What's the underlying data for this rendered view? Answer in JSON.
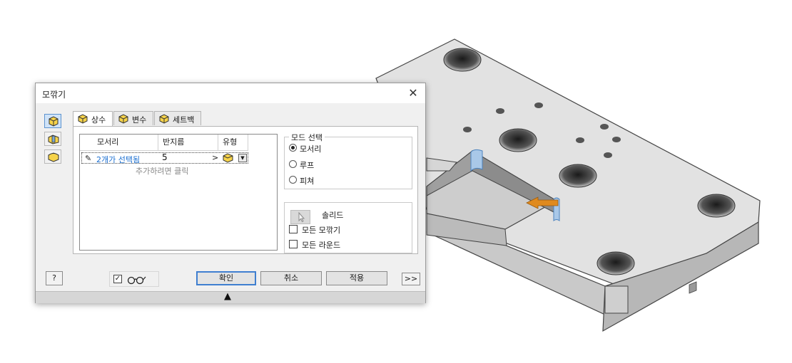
{
  "dialog": {
    "title": "모깎기",
    "close_glyph": "✕"
  },
  "side_tools": [
    {
      "icon": "edge-fillet-icon",
      "active": true
    },
    {
      "icon": "face-fillet-icon",
      "active": false
    },
    {
      "icon": "full-round-fillet-icon",
      "active": false
    }
  ],
  "tabs": [
    {
      "label": "상수",
      "active": true
    },
    {
      "label": "변수",
      "active": false
    },
    {
      "label": "세트백",
      "active": false
    }
  ],
  "table": {
    "headers": [
      "모서리",
      "반지름",
      "유형"
    ],
    "row": {
      "edges": "2개가 선택됨",
      "radius": "5",
      "arrow": ">"
    },
    "hint": "추가하려면 클릭"
  },
  "mode": {
    "legend": "모드 선택",
    "options": [
      "모서리",
      "루프",
      "피쳐"
    ],
    "selected": "모서리"
  },
  "solids": {
    "label": "솔리드",
    "all_fillets": "모든 모깎기",
    "all_rounds": "모든 라운드"
  },
  "buttons": {
    "help": "?",
    "ok": "확인",
    "cancel": "취소",
    "apply": "적용",
    "expand": ">>"
  },
  "preview": {
    "checked": true,
    "check_glyph": "☑"
  },
  "footer": {
    "arrow": "▲"
  },
  "colors": {
    "accent": "#3f7fd0",
    "selected_edges_text": "#1b6fd1",
    "fillet_highlight": "#7aa8d6",
    "drag_arrow": "#e08a1e"
  }
}
